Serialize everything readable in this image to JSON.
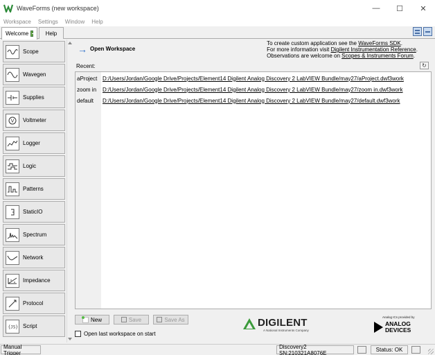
{
  "window": {
    "title": "WaveForms (new workspace)"
  },
  "menu": [
    "Workspace",
    "Settings",
    "Window",
    "Help"
  ],
  "tabs": {
    "welcome": "Welcome",
    "help": "Help"
  },
  "tools": [
    "Scope",
    "Wavegen",
    "Supplies",
    "Voltmeter",
    "Logger",
    "Logic",
    "Patterns",
    "StaticIO",
    "Spectrum",
    "Network",
    "Impedance",
    "Protocol",
    "Script"
  ],
  "main": {
    "open_workspace": "Open Workspace",
    "info_line1_prefix": "To create custom application see the ",
    "info_line1_link": "WaveForms SDK",
    "info_line1_suffix": ".",
    "info_line2_prefix": "For more information visit ",
    "info_line2_link": "Digilent Instrumentation Reference",
    "info_line2_suffix": ".",
    "info_line3_prefix": "Observations are welcome on ",
    "info_line3_link": "Scopes & Instruments Forum",
    "info_line3_suffix": ".",
    "recent_label": "Recent:",
    "recent": [
      {
        "name": "aProject",
        "path": "D:/Users/Jordan/Google Drive/Projects/Element14 Digilent Analog Discovery 2 LabVIEW Bundle/may27/aProject.dwf3work"
      },
      {
        "name": "zoom in",
        "path": "D:/Users/Jordan/Google Drive/Projects/Element14 Digilent Analog Discovery 2 LabVIEW Bundle/may27/zoom in.dwf3work"
      },
      {
        "name": "default",
        "path": "D:/Users/Jordan/Google Drive/Projects/Element14 Digilent Analog Discovery 2 LabVIEW Bundle/may27/default.dwf3work"
      }
    ],
    "new_label": "New",
    "save_label": "Save",
    "save_as_label": "Save As",
    "open_last_label": "Open last workspace on start"
  },
  "branding": {
    "digilent": "DIGILENT",
    "digilent_sub": "A National Instruments Company",
    "adi_sub": "Analog ICs provided by",
    "adi_line1": "ANALOG",
    "adi_line2": "DEVICES"
  },
  "status": {
    "trigger": "Manual Trigger",
    "device": "Discovery2 SN:210321A8076E",
    "status": "Status: OK"
  },
  "colors": {
    "accent": "#2c6fc8",
    "digilent_green": "#3a9a3a"
  },
  "icons": [
    "waveforms-logo-icon",
    "minimize-icon",
    "maximize-icon",
    "close-icon",
    "plus-icon",
    "arrow-right-icon",
    "refresh-icon",
    "save-icon"
  ]
}
